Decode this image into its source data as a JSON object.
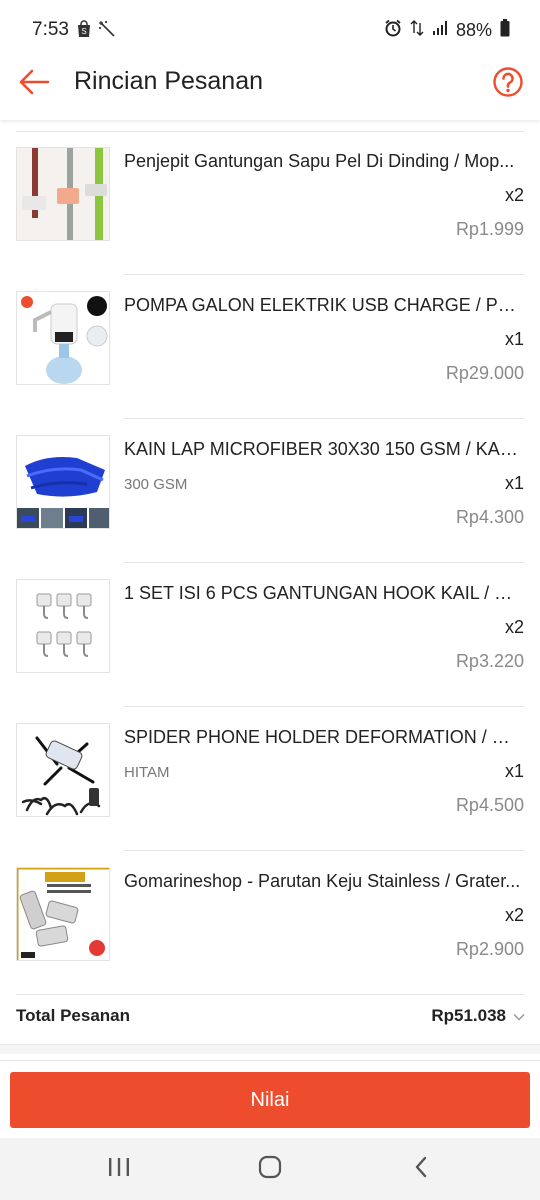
{
  "status_bar": {
    "time": "7:53",
    "battery": "88%",
    "icons": [
      "shopee-bag-icon",
      "magic-wand-icon",
      "alarm-icon",
      "data-arrows-icon",
      "signal-icon",
      "battery-icon"
    ]
  },
  "header": {
    "title": "Rincian Pesanan",
    "back_icon": "arrow-left-icon",
    "help_icon": "question-circle-icon",
    "accent_color": "#ee4d2d"
  },
  "items": [
    {
      "name": "Penjepit Gantungan Sapu Pel Di Dinding / Mop...",
      "variation": "",
      "qty": "x2",
      "price": "Rp1.999",
      "image": "mop-holder-image"
    },
    {
      "name": "POMPA GALON ELEKTRIK USB CHARGE / POM...",
      "variation": "",
      "qty": "x1",
      "price": "Rp29.000",
      "image": "water-pump-image"
    },
    {
      "name": "KAIN LAP MICROFIBER 30X30 150 GSM / KAIN...",
      "variation": "300 GSM",
      "qty": "x1",
      "price": "Rp4.300",
      "image": "microfiber-cloth-image"
    },
    {
      "name": "1 SET ISI 6 PCS GANTUNGAN HOOK KAIL / GA...",
      "variation": "",
      "qty": "x2",
      "price": "Rp3.220",
      "image": "wall-hooks-image"
    },
    {
      "name": "SPIDER PHONE HOLDER DEFORMATION / UNI...",
      "variation": "HITAM",
      "qty": "x1",
      "price": "Rp4.500",
      "image": "spider-phone-holder-image"
    },
    {
      "name": "Gomarineshop - Parutan Keju Stainless / Grater...",
      "variation": "",
      "qty": "x2",
      "price": "Rp2.900",
      "image": "cheese-grater-image"
    }
  ],
  "total": {
    "label": "Total Pesanan",
    "value": "Rp51.038"
  },
  "action": {
    "button_label": "Nilai"
  },
  "nav": {
    "icons": [
      "recent-apps-icon",
      "home-icon",
      "back-icon"
    ]
  }
}
